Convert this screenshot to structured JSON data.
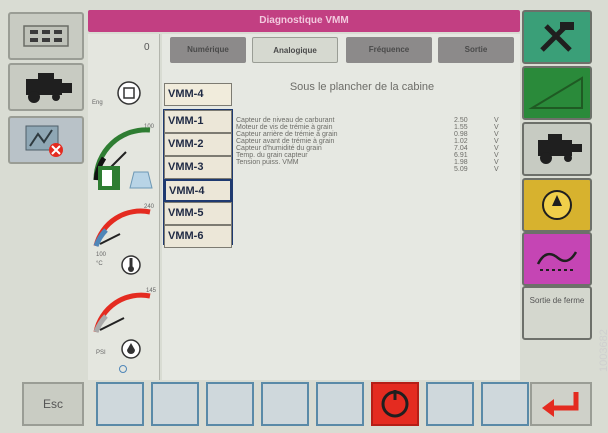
{
  "header": {
    "title": "Diagnostique VMM"
  },
  "colors": {
    "title_bar": "#c23f82",
    "tab_active": "#d6d9d0",
    "tab_inactive": "#8c8a8a",
    "panel": "#e4e6df",
    "vmm_highlight": "#1f3a70",
    "red": "#e42b20"
  },
  "tabs": [
    {
      "label": "Numérique"
    },
    {
      "label": "Analogique"
    },
    {
      "label": "Fréquence"
    },
    {
      "label": "Sortie"
    }
  ],
  "left_panel": {
    "count_value": "0",
    "engine_label": "Eng",
    "fuel_value": "100",
    "temp_value": "240",
    "temp_small": "100",
    "temp_unit": "°C",
    "pressure_value": "145",
    "pressure_unit": "PSI"
  },
  "vmm_list": {
    "selected": "VMM-4",
    "items": [
      "VMM-1",
      "VMM-2",
      "VMM-3",
      "VMM-4",
      "VMM-5",
      "VMM-6"
    ]
  },
  "content": {
    "heading": "Sous le plancher de la cabine",
    "readings": [
      {
        "label": "Capteur de niveau de carburant",
        "value": "2.50",
        "unit": "V"
      },
      {
        "label": "Moteur de vis de trémie à grain",
        "value": "1.55",
        "unit": "V"
      },
      {
        "label": "Capteur arrière de trémie à grain",
        "value": "0.98",
        "unit": "V"
      },
      {
        "label": "Capteur avant de trémie à grain",
        "value": "1.02",
        "unit": "V"
      },
      {
        "label": "Capteur d'humidité du grain",
        "value": "7.04",
        "unit": "V"
      },
      {
        "label": "Temp. du grain capteur",
        "value": "6.91",
        "unit": "V"
      },
      {
        "label": "Tension puiss. VMM",
        "value": "1.98",
        "unit": "V"
      },
      {
        "label": "",
        "value": "5.09",
        "unit": "V"
      }
    ]
  },
  "right_panel": {
    "exit_label": "Sortie de ferme"
  },
  "footer": {
    "esc_label": "Esc",
    "figure_id": "1003682"
  }
}
